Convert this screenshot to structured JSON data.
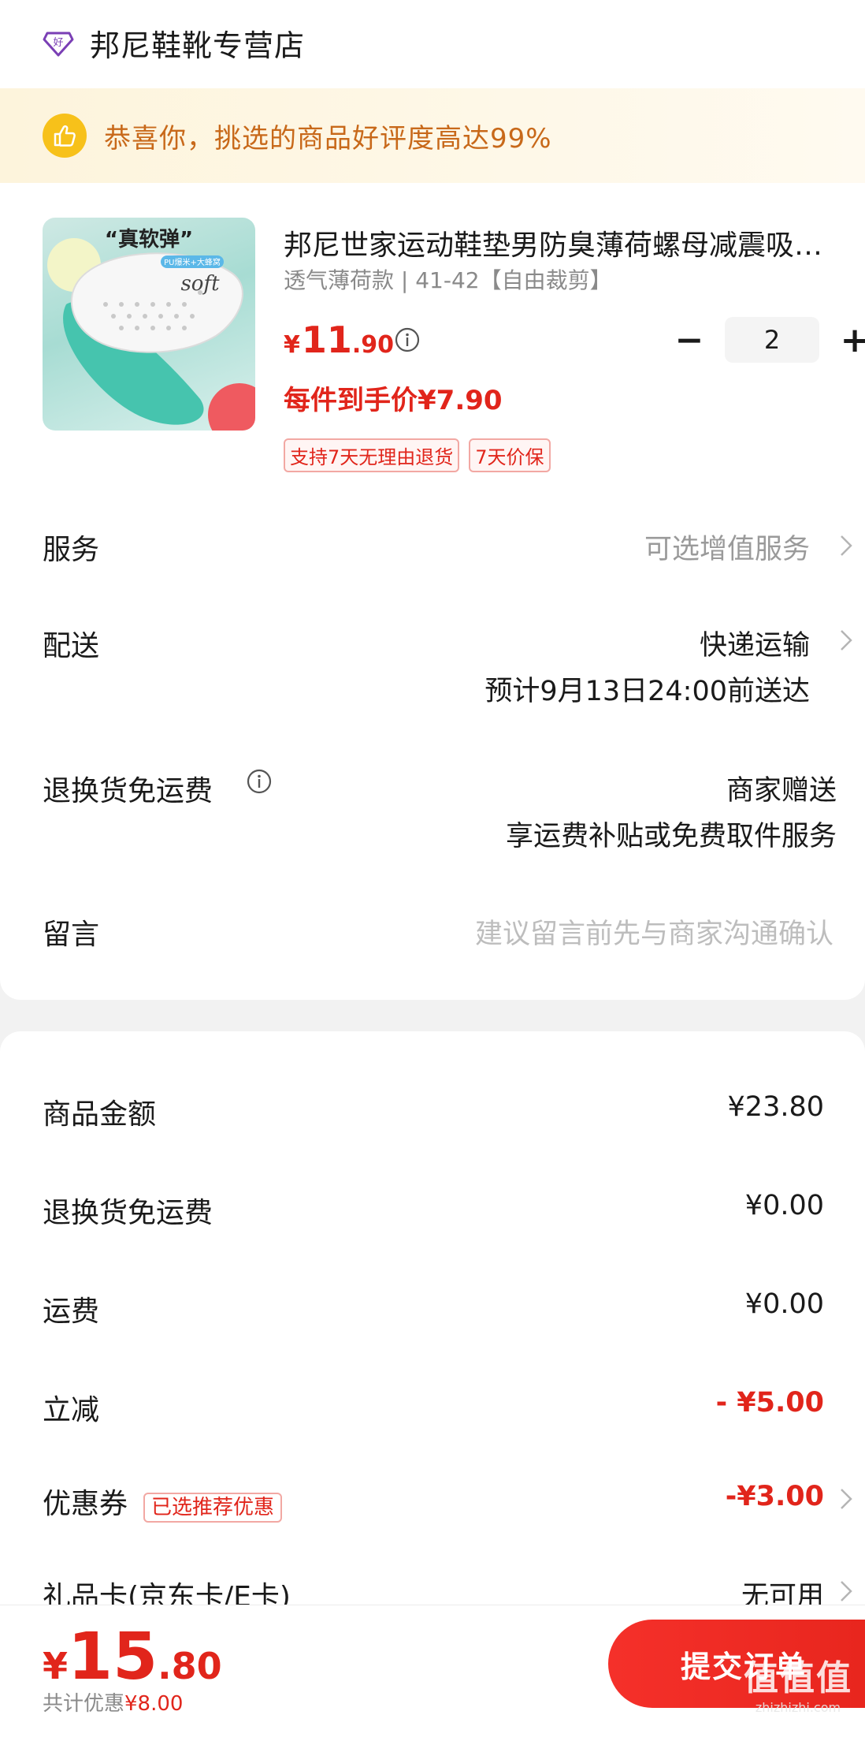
{
  "shop": {
    "name": "邦尼鞋靴专营店",
    "logo_icon": "good-shop-gem-icon"
  },
  "banner": {
    "icon": "thumbs-up-icon",
    "text": "恭喜你，挑选的商品好评度高达99%"
  },
  "product": {
    "image_lettering": "“真软弹” PU爆米+大蜂窝 soft",
    "title": "邦尼世家运动鞋垫男防臭薄荷螺母减震吸汗透气",
    "spec": "透气薄荷款 | 41-42【自由裁剪】",
    "price_symbol": "¥",
    "price_int": "11",
    "price_dec": ".90",
    "per_item_price": "每件到手价¥7.90",
    "tags": [
      "支持7天无理由退货",
      "7天价保"
    ],
    "quantity": "2",
    "minus_label": "−",
    "plus_label": "+"
  },
  "rows": {
    "service": {
      "label": "服务",
      "value": "可选增值服务"
    },
    "delivery": {
      "label": "配送",
      "value": "快递运输",
      "eta": "预计9月13日24:00前送达"
    },
    "return_freight": {
      "label": "退换货免运费",
      "value": "商家赠送",
      "sub": "享运费补贴或免费取件服务"
    },
    "message": {
      "label": "留言",
      "placeholder": "建议留言前先与商家沟通确认"
    }
  },
  "summary": {
    "goods_amount": {
      "label": "商品金额",
      "value": "¥23.80"
    },
    "return_freight": {
      "label": "退换货免运费",
      "value": "¥0.00"
    },
    "freight": {
      "label": "运费",
      "value": "¥0.00"
    },
    "instant_discount": {
      "label": "立减",
      "value": "- ¥5.00"
    },
    "coupon": {
      "label": "优惠券",
      "tag": "已选推荐优惠",
      "value": "-¥3.00"
    },
    "gift_card": {
      "label": "礼品卡(京东卡/E卡)",
      "value": "无可用"
    }
  },
  "footer": {
    "total_symbol": "¥",
    "total_int": "15",
    "total_dec": ".80",
    "saving_label": "共计优惠",
    "saving_value": "¥8.00",
    "submit_label": "提交订单",
    "watermark_big": "值值值",
    "watermark_small": "zhizhizhi.com"
  },
  "colors": {
    "accent_red": "#e1251b",
    "banner_text": "#c8691a",
    "banner_bg": "#fdf4dc"
  }
}
